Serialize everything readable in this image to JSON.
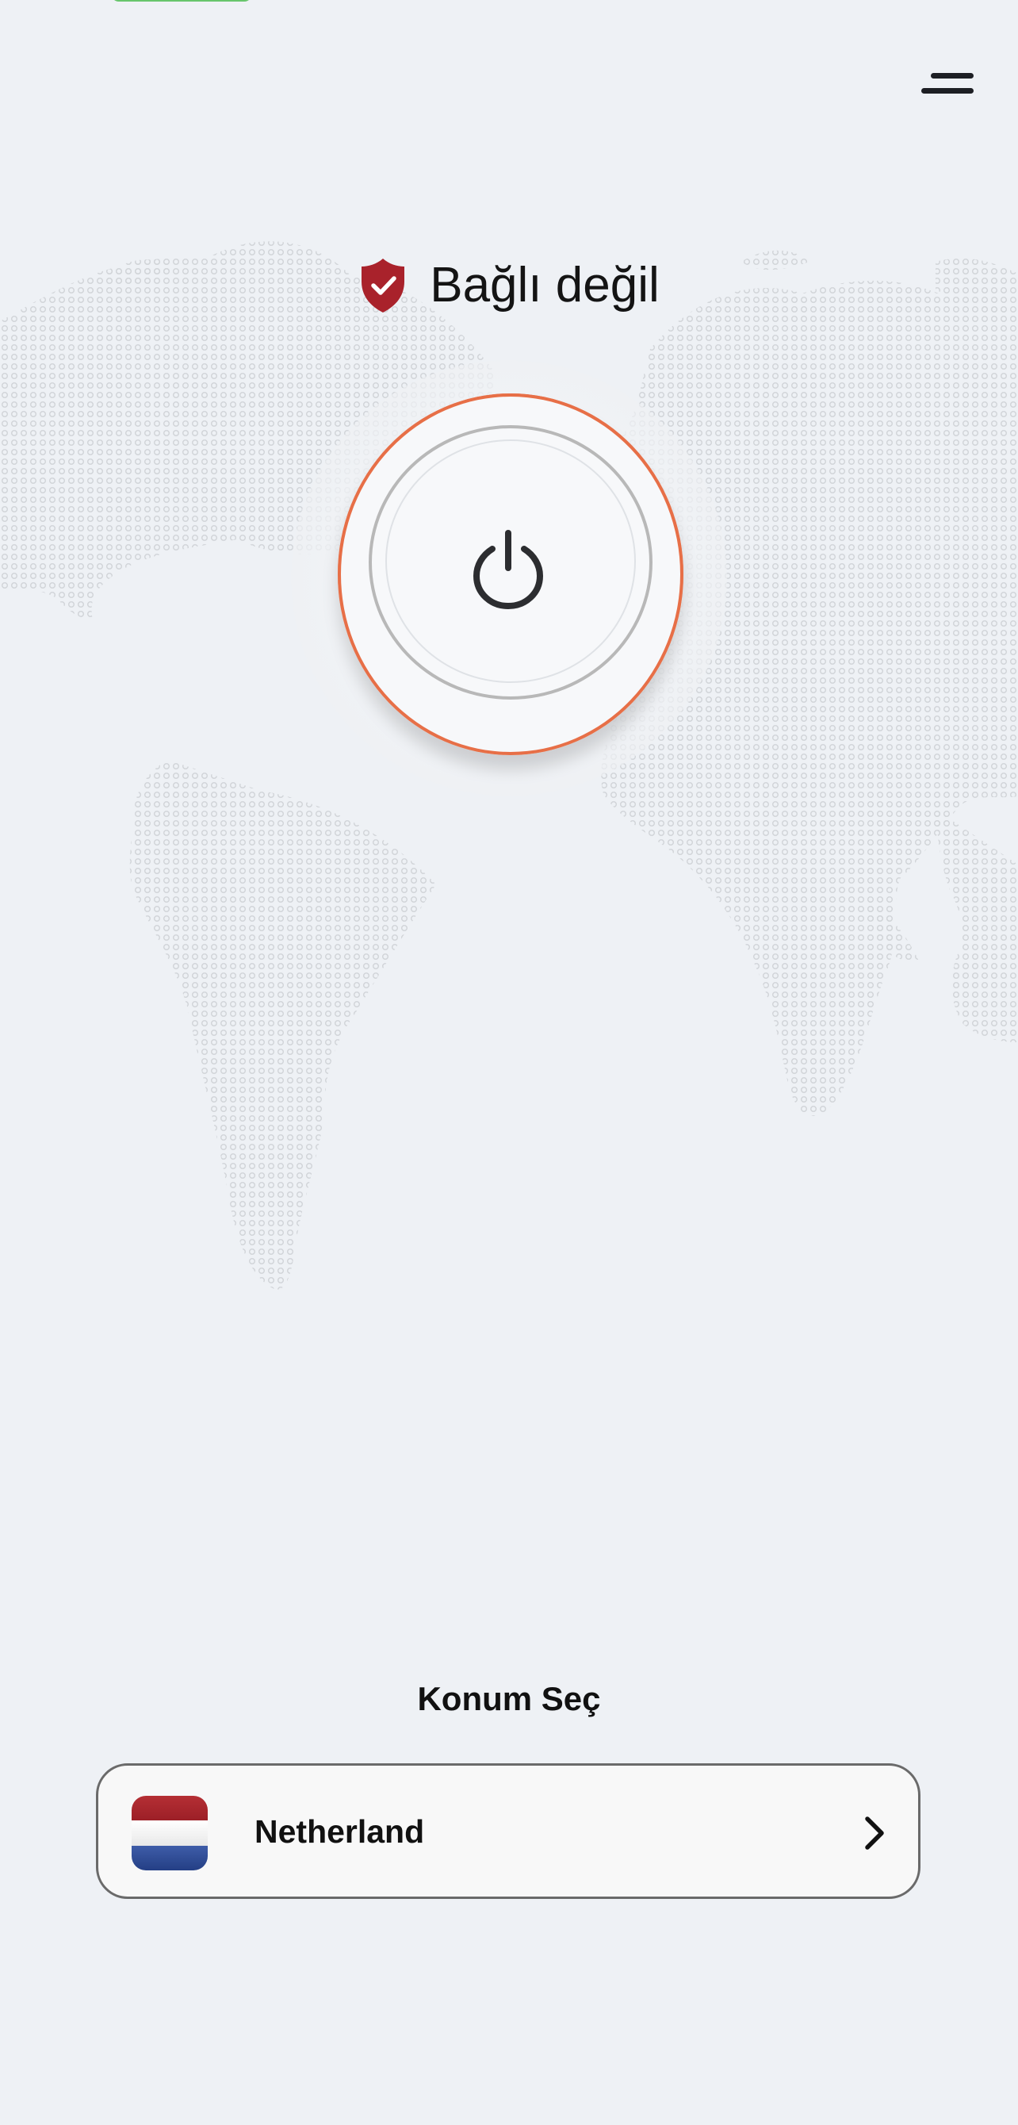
{
  "header": {
    "menu_icon": "menu-icon"
  },
  "status": {
    "text": "Bağlı değil",
    "shield_icon": "shield-check-icon",
    "shield_color": "#a9222b"
  },
  "power": {
    "icon": "power-icon",
    "accent_color": "#e76f47"
  },
  "location": {
    "label": "Konum Seç",
    "selected": "Netherland",
    "flag_icon": "netherlands-flag-icon",
    "chevron_icon": "chevron-right-icon"
  },
  "background": {
    "map_icon": "world-map-icon"
  }
}
